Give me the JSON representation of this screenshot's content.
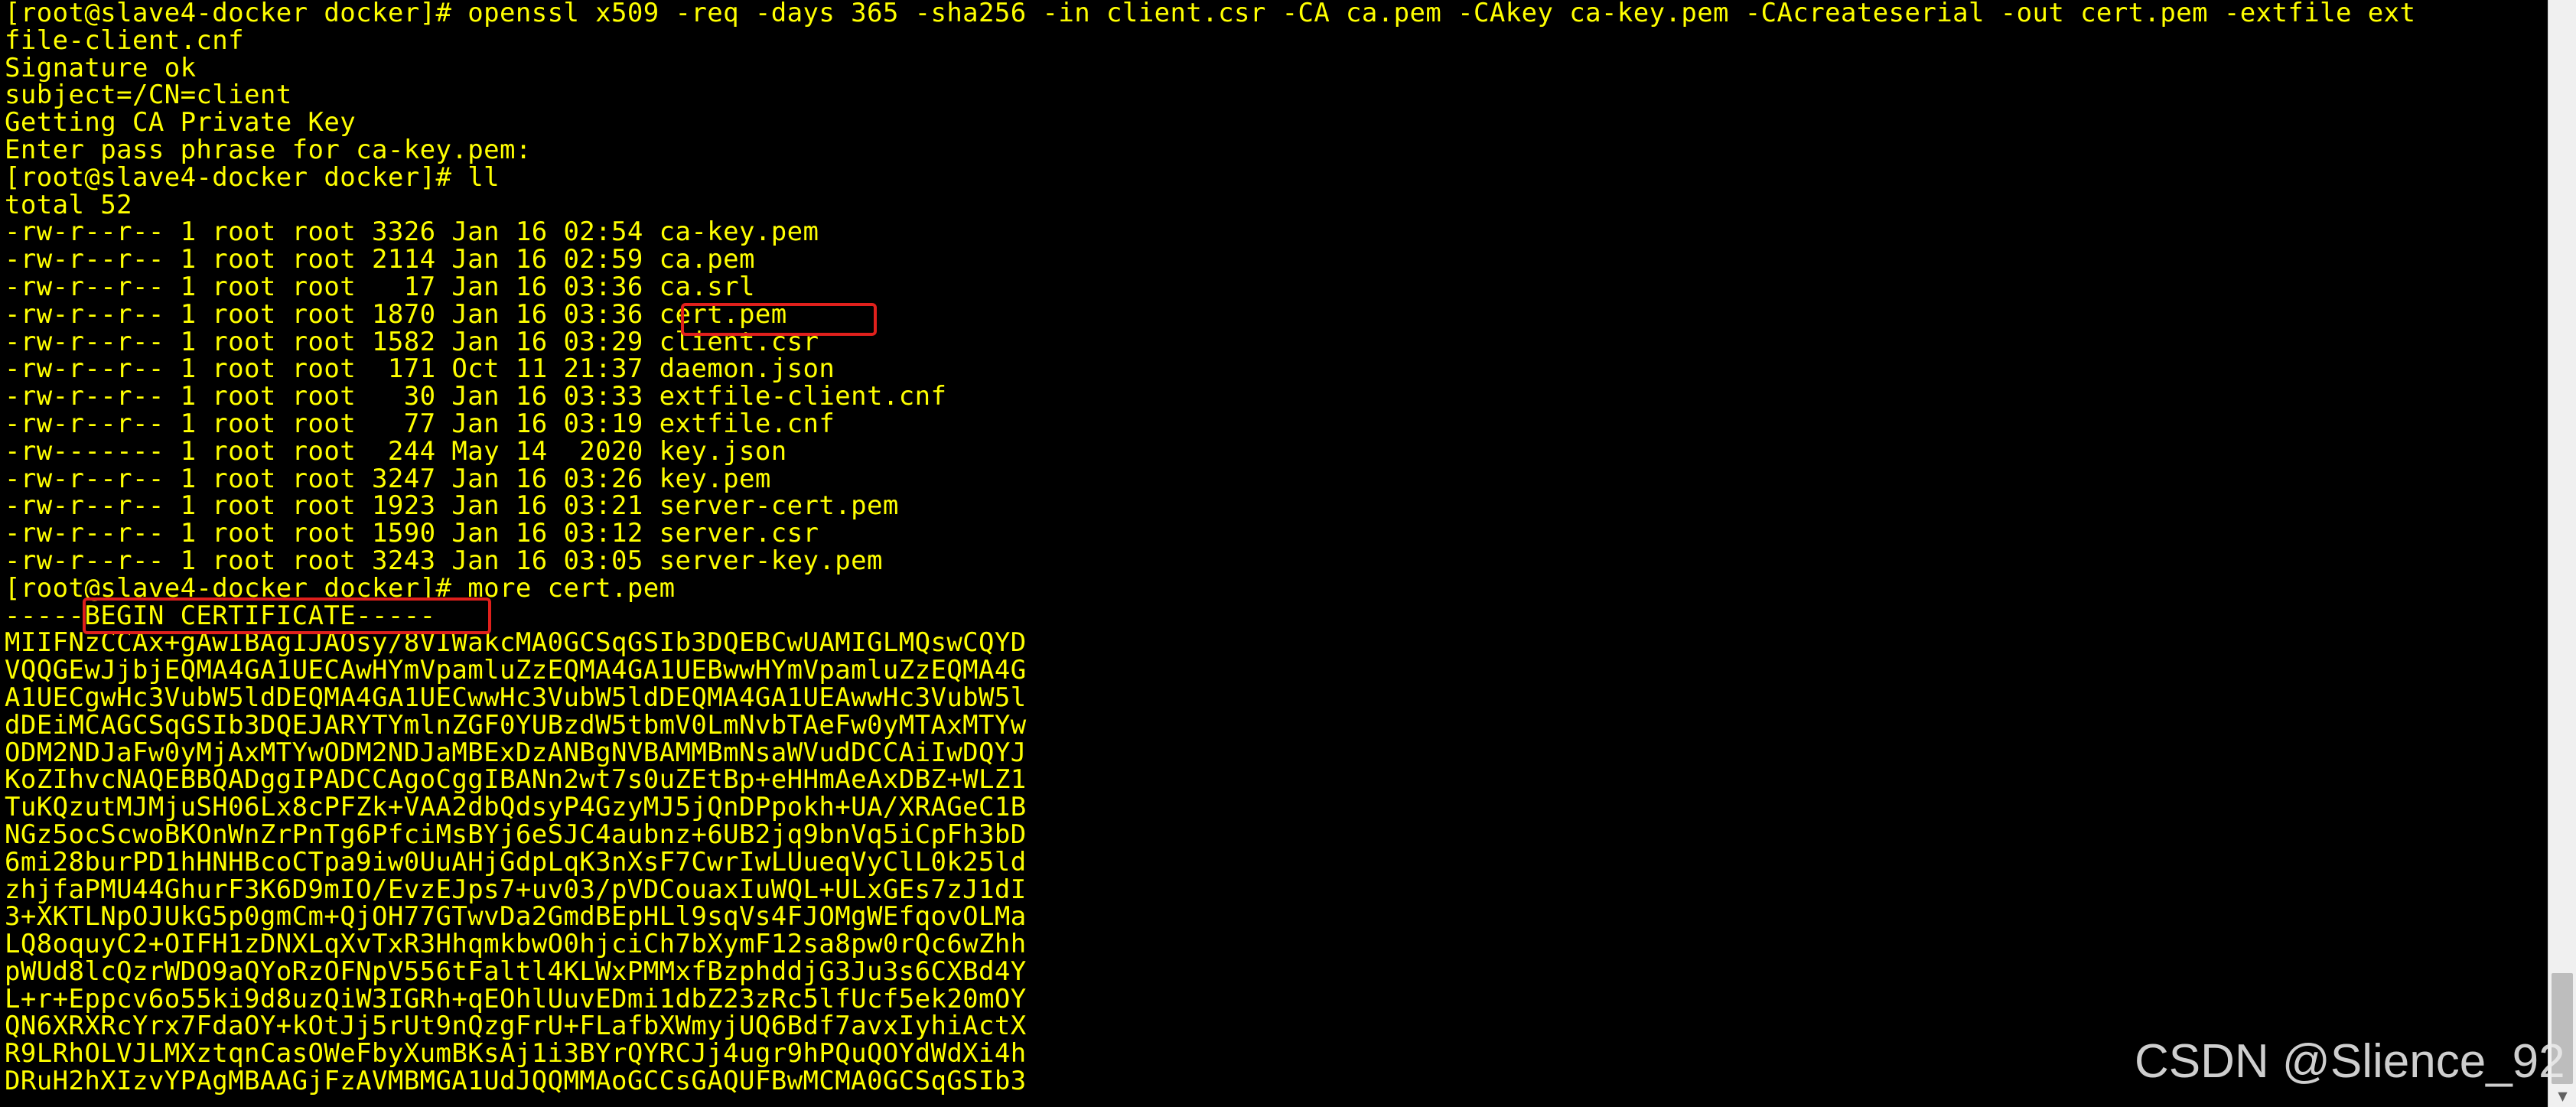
{
  "terminal": {
    "foreground": "#ffff00",
    "background": "#000000",
    "lines": [
      "[root@slave4-docker docker]# openssl x509 -req -days 365 -sha256 -in client.csr -CA ca.pem -CAkey ca-key.pem -CAcreateserial -out cert.pem -extfile ext",
      "file-client.cnf",
      "Signature ok",
      "subject=/CN=client",
      "Getting CA Private Key",
      "Enter pass phrase for ca-key.pem:",
      "[root@slave4-docker docker]# ll",
      "total 52",
      "-rw-r--r-- 1 root root 3326 Jan 16 02:54 ca-key.pem",
      "-rw-r--r-- 1 root root 2114 Jan 16 02:59 ca.pem",
      "-rw-r--r-- 1 root root   17 Jan 16 03:36 ca.srl",
      "-rw-r--r-- 1 root root 1870 Jan 16 03:36 cert.pem",
      "-rw-r--r-- 1 root root 1582 Jan 16 03:29 client.csr",
      "-rw-r--r-- 1 root root  171 Oct 11 21:37 daemon.json",
      "-rw-r--r-- 1 root root   30 Jan 16 03:33 extfile-client.cnf",
      "-rw-r--r-- 1 root root   77 Jan 16 03:19 extfile.cnf",
      "-rw------- 1 root root  244 May 14  2020 key.json",
      "-rw-r--r-- 1 root root 3247 Jan 16 03:26 key.pem",
      "-rw-r--r-- 1 root root 1923 Jan 16 03:21 server-cert.pem",
      "-rw-r--r-- 1 root root 1590 Jan 16 03:12 server.csr",
      "-rw-r--r-- 1 root root 3243 Jan 16 03:05 server-key.pem",
      "[root@slave4-docker docker]# more cert.pem",
      "-----BEGIN CERTIFICATE-----",
      "MIIFNzCCAx+gAwIBAgIJAOsy/8VIWakcMA0GCSqGSIb3DQEBCwUAMIGLMQswCQYD",
      "VQQGEwJjbjEQMA4GA1UECAwHYmVpamluZzEQMA4GA1UEBwwHYmVpamluZzEQMA4G",
      "A1UECgwHc3VubW5ldDEQMA4GA1UECwwHc3VubW5ldDEQMA4GA1UEAwwHc3VubW5l",
      "dDEiMCAGCSqGSIb3DQEJARYTYmlnZGF0YUBzdW5tbmV0LmNvbTAeFw0yMTAxMTYw",
      "ODM2NDJaFw0yMjAxMTYwODM2NDJaMBExDzANBgNVBAMMBmNsaWVudDCCAiIwDQYJ",
      "KoZIhvcNAQEBBQADggIPADCCAgoCggIBANn2wt7s0uZEtBp+eHHmAeAxDBZ+WLZ1",
      "TuKQzutMJMjuSH06Lx8cPFZk+VAA2dbQdsyP4GzyMJ5jQnDPpokh+UA/XRAGeC1B",
      "NGz5ocScwoBKOnWnZrPnTg6PfciMsBYj6eSJC4aubnz+6UB2jq9bnVq5iCpFh3bD",
      "6mi28burPD1hHNHBcoCTpa9iw0UuAHjGdpLqK3nXsF7CwrIwLUueqVyClL0k25ld",
      "zhjfaPMU44GhurF3K6D9mIO/EvzEJps7+uv03/pVDCouaxIuWQL+ULxGEs7zJ1dI",
      "3+XKTLNpOJUkG5p0gmCm+QjOH77GTwvDa2GmdBEpHLl9sqVs4FJOMgWEfqovOLMa",
      "LQ8oquyC2+OIFH1zDNXLqXvTxR3HhqmkbwO0hjciCh7bXymF12sa8pw0rQc6wZhh",
      "pWUd8lcQzrWDO9aQYoRzOFNpV556tFaltl4KLWxPMMxfBzphddjG3Ju3s6CXBd4Y",
      "L+r+Eppcv6o55ki9d8uzQiW3IGRh+qEOhlUuvEDmi1dbZ23zRc5lfUcf5ek20mOY",
      "QN6XRXRcYrx7FdaOY+kOtJj5rUt9nQzgFrU+FLafbXWmyjUQ6Bdf7avxIyhiActX",
      "R9LRhOLVJLMXztqnCasOWeFbyXumBKsAj1i3BYrQYRCJj4ugr9hPQuQOYdWdXi4h",
      "DRuH2hXIzvYPAgMBAAGjFzAVMBMGA1UdJQQMMAoGCCsGAQUFBwMCMA0GCSqGSIb3"
    ]
  },
  "annotations": {
    "highlight_color": "#e0201c",
    "boxes": [
      "cert.pem",
      "BEGIN CERTIFICATE-----"
    ]
  },
  "watermark": {
    "text": "CSDN @Slience_92"
  }
}
